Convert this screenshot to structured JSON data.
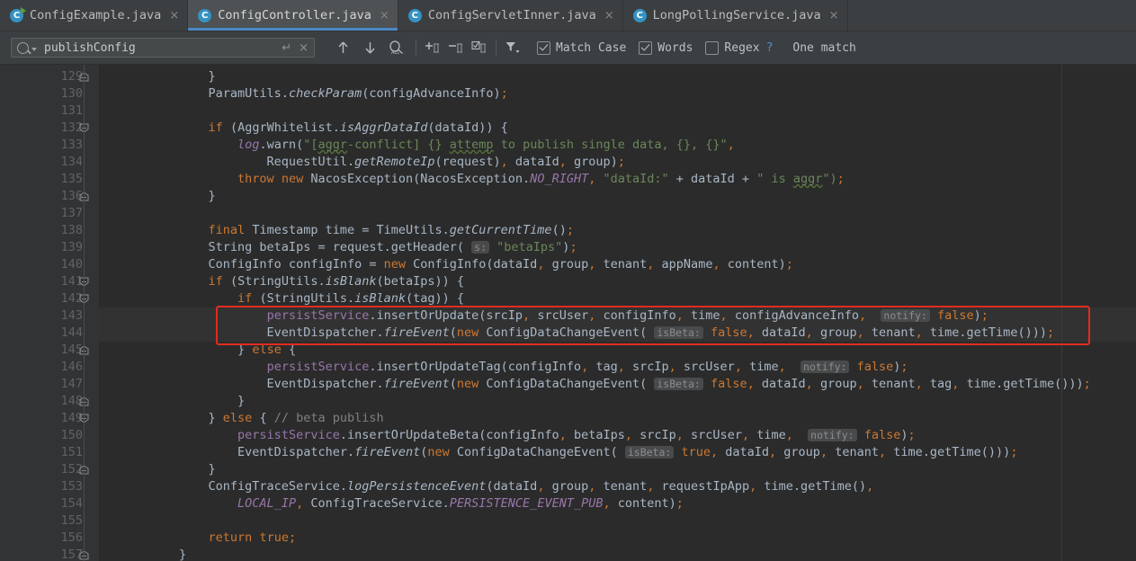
{
  "window": {
    "app": "IntelliJ IDEA editor",
    "theme_bg": "#2b2b2b",
    "accent": "#4a88c7",
    "highlight_box_color": "#e32b20"
  },
  "tabs": [
    {
      "label": "ConfigExample.java",
      "icon": "java-class-runnable-icon",
      "active": false,
      "close": "×"
    },
    {
      "label": "ConfigController.java",
      "icon": "java-class-icon",
      "active": true,
      "close": "×"
    },
    {
      "label": "ConfigServletInner.java",
      "icon": "java-class-icon",
      "active": false,
      "close": "×"
    },
    {
      "label": "LongPollingService.java",
      "icon": "java-class-icon",
      "active": false,
      "close": "×"
    }
  ],
  "find_toolbar": {
    "search_value": "publishConfig",
    "search_placeholder": "Search",
    "enter_icon": "↵",
    "clear_icon": "×",
    "buttons": [
      {
        "name": "find-previous-button",
        "glyph": "↑"
      },
      {
        "name": "find-next-button",
        "glyph": "↓"
      },
      {
        "name": "select-all-occurrences-button",
        "glyph": "ALL"
      },
      {
        "name": "add-line-to-selection-button",
        "glyph": "+"
      },
      {
        "name": "remove-line-from-selection-button",
        "glyph": "−"
      },
      {
        "name": "select-all-lines-button",
        "glyph": "☑"
      },
      {
        "name": "filter-search-results-button",
        "glyph": "filter"
      }
    ],
    "options": [
      {
        "name": "match-case-checkbox",
        "label": "Match Case",
        "checked": true
      },
      {
        "name": "words-checkbox",
        "label": "Words",
        "checked": true
      },
      {
        "name": "regex-checkbox",
        "label": "Regex",
        "checked": false
      }
    ],
    "help_glyph": "?",
    "match_count_text": "One match"
  },
  "editor": {
    "first_line": 129,
    "last_line": 157,
    "fold_lines": [
      129,
      132,
      136,
      141,
      142,
      145,
      148,
      149,
      152,
      157
    ],
    "fold_expanded_lines": [
      132,
      141,
      142,
      149
    ],
    "highlight_box": {
      "from_line": 143,
      "to_line": 144
    },
    "lines": [
      {
        "n": 129,
        "tokens": [
          {
            "t": "            }"
          }
        ]
      },
      {
        "n": 130,
        "tokens": [
          {
            "t": "            ParamUtils."
          },
          {
            "t": "checkParam",
            "c": "itl"
          },
          {
            "t": "(configAdvanceInfo)"
          },
          {
            "t": ";",
            "c": "kw"
          }
        ]
      },
      {
        "n": 131,
        "tokens": [
          {
            "t": ""
          }
        ]
      },
      {
        "n": 132,
        "tokens": [
          {
            "t": "            "
          },
          {
            "t": "if",
            "c": "kw"
          },
          {
            "t": " (AggrWhitelist."
          },
          {
            "t": "isAggrDataId",
            "c": "itl"
          },
          {
            "t": "(dataId)) {"
          }
        ]
      },
      {
        "n": 133,
        "tokens": [
          {
            "t": "                "
          },
          {
            "t": "log",
            "c": "fld itl"
          },
          {
            "t": ".warn("
          },
          {
            "t": "\"[",
            "c": "str"
          },
          {
            "t": "aggr",
            "c": "str sq"
          },
          {
            "t": "-conflict] {} ",
            "c": "str"
          },
          {
            "t": "attemp",
            "c": "str sq"
          },
          {
            "t": " to publish single data, {}, {}\"",
            "c": "str"
          },
          {
            "t": ",",
            "c": "kw"
          }
        ]
      },
      {
        "n": 134,
        "tokens": [
          {
            "t": "                    RequestUtil."
          },
          {
            "t": "getRemoteIp",
            "c": "itl"
          },
          {
            "t": "(request)"
          },
          {
            "t": ",",
            "c": "kw"
          },
          {
            "t": " dataId"
          },
          {
            "t": ",",
            "c": "kw"
          },
          {
            "t": " group)"
          },
          {
            "t": ";",
            "c": "kw"
          }
        ]
      },
      {
        "n": 135,
        "tokens": [
          {
            "t": "                "
          },
          {
            "t": "throw",
            "c": "kw"
          },
          {
            "t": " "
          },
          {
            "t": "new",
            "c": "kw"
          },
          {
            "t": " NacosException(NacosException."
          },
          {
            "t": "NO_RIGHT",
            "c": "stfld"
          },
          {
            "t": ",",
            "c": "kw"
          },
          {
            "t": " "
          },
          {
            "t": "\"dataId:\"",
            "c": "str"
          },
          {
            "t": " + dataId + "
          },
          {
            "t": "\" is ",
            "c": "str"
          },
          {
            "t": "aggr",
            "c": "str sq"
          },
          {
            "t": "\")",
            "c": "str"
          },
          {
            "t": ";",
            "c": "kw"
          }
        ]
      },
      {
        "n": 136,
        "tokens": [
          {
            "t": "            }"
          }
        ]
      },
      {
        "n": 137,
        "tokens": [
          {
            "t": ""
          }
        ]
      },
      {
        "n": 138,
        "tokens": [
          {
            "t": "            "
          },
          {
            "t": "final",
            "c": "kw"
          },
          {
            "t": " Timestamp time = TimeUtils."
          },
          {
            "t": "getCurrentTime",
            "c": "itl"
          },
          {
            "t": "()"
          },
          {
            "t": ";",
            "c": "kw"
          }
        ]
      },
      {
        "n": 139,
        "tokens": [
          {
            "t": "            String betaIps = request.getHeader( "
          },
          {
            "t": "s:",
            "c": "hintspan"
          },
          {
            "t": " "
          },
          {
            "t": "\"betaIps\"",
            "c": "str"
          },
          {
            "t": ")"
          },
          {
            "t": ";",
            "c": "kw"
          }
        ]
      },
      {
        "n": 140,
        "tokens": [
          {
            "t": "            ConfigInfo configInfo = "
          },
          {
            "t": "new",
            "c": "kw"
          },
          {
            "t": " ConfigInfo(dataId"
          },
          {
            "t": ",",
            "c": "kw"
          },
          {
            "t": " group"
          },
          {
            "t": ",",
            "c": "kw"
          },
          {
            "t": " tenant"
          },
          {
            "t": ",",
            "c": "kw"
          },
          {
            "t": " appName"
          },
          {
            "t": ",",
            "c": "kw"
          },
          {
            "t": " content)"
          },
          {
            "t": ";",
            "c": "kw"
          }
        ]
      },
      {
        "n": 141,
        "tokens": [
          {
            "t": "            "
          },
          {
            "t": "if",
            "c": "kw"
          },
          {
            "t": " (StringUtils."
          },
          {
            "t": "isBlank",
            "c": "itl"
          },
          {
            "t": "(betaIps)) {"
          }
        ]
      },
      {
        "n": 142,
        "tokens": [
          {
            "t": "                "
          },
          {
            "t": "if",
            "c": "kw"
          },
          {
            "t": " (StringUtils."
          },
          {
            "t": "isBlank",
            "c": "itl"
          },
          {
            "t": "(tag)) {"
          }
        ]
      },
      {
        "n": 143,
        "tokens": [
          {
            "t": "                    "
          },
          {
            "t": "persistService",
            "c": "fld"
          },
          {
            "t": ".insertOrUpdate(srcIp"
          },
          {
            "t": ",",
            "c": "kw"
          },
          {
            "t": " srcUser"
          },
          {
            "t": ",",
            "c": "kw"
          },
          {
            "t": " configInfo"
          },
          {
            "t": ",",
            "c": "kw"
          },
          {
            "t": " time"
          },
          {
            "t": ",",
            "c": "kw"
          },
          {
            "t": " configAdvanceInfo"
          },
          {
            "t": ",",
            "c": "kw"
          },
          {
            "t": "  "
          },
          {
            "t": "notify:",
            "c": "hintspan"
          },
          {
            "t": " "
          },
          {
            "t": "false",
            "c": "kw"
          },
          {
            "t": ")"
          },
          {
            "t": ";",
            "c": "kw"
          }
        ]
      },
      {
        "n": 144,
        "tokens": [
          {
            "t": "                    EventDispatcher."
          },
          {
            "t": "fireEvent",
            "c": "itl"
          },
          {
            "t": "("
          },
          {
            "t": "new",
            "c": "kw"
          },
          {
            "t": " ConfigDataChangeEvent( "
          },
          {
            "t": "isBeta:",
            "c": "hintspan"
          },
          {
            "t": " "
          },
          {
            "t": "false",
            "c": "kw"
          },
          {
            "t": ",",
            "c": "kw"
          },
          {
            "t": " dataId"
          },
          {
            "t": ",",
            "c": "kw"
          },
          {
            "t": " group"
          },
          {
            "t": ",",
            "c": "kw"
          },
          {
            "t": " tenant"
          },
          {
            "t": ",",
            "c": "kw"
          },
          {
            "t": " time.getTime()))"
          },
          {
            "t": ";",
            "c": "kw"
          }
        ]
      },
      {
        "n": 145,
        "tokens": [
          {
            "t": "                } "
          },
          {
            "t": "else",
            "c": "kw"
          },
          {
            "t": " {"
          }
        ]
      },
      {
        "n": 146,
        "tokens": [
          {
            "t": "                    "
          },
          {
            "t": "persistService",
            "c": "fld"
          },
          {
            "t": ".insertOrUpdateTag(configInfo"
          },
          {
            "t": ",",
            "c": "kw"
          },
          {
            "t": " tag"
          },
          {
            "t": ",",
            "c": "kw"
          },
          {
            "t": " srcIp"
          },
          {
            "t": ",",
            "c": "kw"
          },
          {
            "t": " srcUser"
          },
          {
            "t": ",",
            "c": "kw"
          },
          {
            "t": " time"
          },
          {
            "t": ",",
            "c": "kw"
          },
          {
            "t": "  "
          },
          {
            "t": "notify:",
            "c": "hintspan"
          },
          {
            "t": " "
          },
          {
            "t": "false",
            "c": "kw"
          },
          {
            "t": ")"
          },
          {
            "t": ";",
            "c": "kw"
          }
        ]
      },
      {
        "n": 147,
        "tokens": [
          {
            "t": "                    EventDispatcher."
          },
          {
            "t": "fireEvent",
            "c": "itl"
          },
          {
            "t": "("
          },
          {
            "t": "new",
            "c": "kw"
          },
          {
            "t": " ConfigDataChangeEvent( "
          },
          {
            "t": "isBeta:",
            "c": "hintspan"
          },
          {
            "t": " "
          },
          {
            "t": "false",
            "c": "kw"
          },
          {
            "t": ",",
            "c": "kw"
          },
          {
            "t": " dataId"
          },
          {
            "t": ",",
            "c": "kw"
          },
          {
            "t": " group"
          },
          {
            "t": ",",
            "c": "kw"
          },
          {
            "t": " tenant"
          },
          {
            "t": ",",
            "c": "kw"
          },
          {
            "t": " tag"
          },
          {
            "t": ",",
            "c": "kw"
          },
          {
            "t": " time.getTime()))"
          },
          {
            "t": ";",
            "c": "kw"
          }
        ]
      },
      {
        "n": 148,
        "tokens": [
          {
            "t": "                }"
          }
        ]
      },
      {
        "n": 149,
        "tokens": [
          {
            "t": "            } "
          },
          {
            "t": "else",
            "c": "kw"
          },
          {
            "t": " { "
          },
          {
            "t": "// beta publish",
            "c": "cmt"
          }
        ]
      },
      {
        "n": 150,
        "tokens": [
          {
            "t": "                "
          },
          {
            "t": "persistService",
            "c": "fld"
          },
          {
            "t": ".insertOrUpdateBeta(configInfo"
          },
          {
            "t": ",",
            "c": "kw"
          },
          {
            "t": " betaIps"
          },
          {
            "t": ",",
            "c": "kw"
          },
          {
            "t": " srcIp"
          },
          {
            "t": ",",
            "c": "kw"
          },
          {
            "t": " srcUser"
          },
          {
            "t": ",",
            "c": "kw"
          },
          {
            "t": " time"
          },
          {
            "t": ",",
            "c": "kw"
          },
          {
            "t": "  "
          },
          {
            "t": "notify:",
            "c": "hintspan"
          },
          {
            "t": " "
          },
          {
            "t": "false",
            "c": "kw"
          },
          {
            "t": ")"
          },
          {
            "t": ";",
            "c": "kw"
          }
        ]
      },
      {
        "n": 151,
        "tokens": [
          {
            "t": "                EventDispatcher."
          },
          {
            "t": "fireEvent",
            "c": "itl"
          },
          {
            "t": "("
          },
          {
            "t": "new",
            "c": "kw"
          },
          {
            "t": " ConfigDataChangeEvent( "
          },
          {
            "t": "isBeta:",
            "c": "hintspan"
          },
          {
            "t": " "
          },
          {
            "t": "true",
            "c": "kw"
          },
          {
            "t": ",",
            "c": "kw"
          },
          {
            "t": " dataId"
          },
          {
            "t": ",",
            "c": "kw"
          },
          {
            "t": " group"
          },
          {
            "t": ",",
            "c": "kw"
          },
          {
            "t": " tenant"
          },
          {
            "t": ",",
            "c": "kw"
          },
          {
            "t": " time.getTime()))"
          },
          {
            "t": ";",
            "c": "kw"
          }
        ]
      },
      {
        "n": 152,
        "tokens": [
          {
            "t": "            }"
          }
        ]
      },
      {
        "n": 153,
        "tokens": [
          {
            "t": "            ConfigTraceService."
          },
          {
            "t": "logPersistenceEvent",
            "c": "itl"
          },
          {
            "t": "(dataId"
          },
          {
            "t": ",",
            "c": "kw"
          },
          {
            "t": " group"
          },
          {
            "t": ",",
            "c": "kw"
          },
          {
            "t": " tenant"
          },
          {
            "t": ",",
            "c": "kw"
          },
          {
            "t": " requestIpApp"
          },
          {
            "t": ",",
            "c": "kw"
          },
          {
            "t": " time.getTime()"
          },
          {
            "t": ",",
            "c": "kw"
          }
        ]
      },
      {
        "n": 154,
        "tokens": [
          {
            "t": "                "
          },
          {
            "t": "LOCAL_IP",
            "c": "stfld"
          },
          {
            "t": ",",
            "c": "kw"
          },
          {
            "t": " ConfigTraceService."
          },
          {
            "t": "PERSISTENCE_EVENT_PUB",
            "c": "stfld"
          },
          {
            "t": ",",
            "c": "kw"
          },
          {
            "t": " content)"
          },
          {
            "t": ";",
            "c": "kw"
          }
        ]
      },
      {
        "n": 155,
        "tokens": [
          {
            "t": ""
          }
        ]
      },
      {
        "n": 156,
        "tokens": [
          {
            "t": "            "
          },
          {
            "t": "return",
            "c": "kw"
          },
          {
            "t": " "
          },
          {
            "t": "true",
            "c": "kw"
          },
          {
            "t": ";",
            "c": "kw"
          }
        ]
      },
      {
        "n": 157,
        "tokens": [
          {
            "t": "        }"
          }
        ]
      }
    ]
  }
}
